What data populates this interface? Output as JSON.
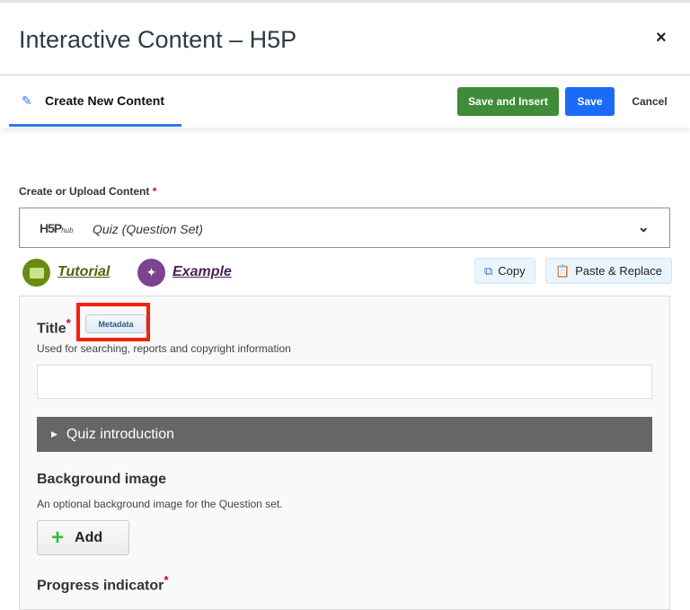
{
  "dialog": {
    "title": "Interactive Content – H5P",
    "close_icon": "×"
  },
  "toolbar": {
    "tab_label": "Create New Content",
    "save_and_insert": "Save and Insert",
    "save": "Save",
    "cancel": "Cancel"
  },
  "content": {
    "label": "Create or Upload Content",
    "required": "*",
    "hub_logo": "H5P",
    "hub_sub": "hub",
    "selected": "Quiz (Question Set)",
    "tutorial": "Tutorial",
    "example": "Example",
    "copy": "Copy",
    "paste": "Paste & Replace"
  },
  "form": {
    "title_label": "Title",
    "required": "*",
    "metadata": "Metadata",
    "title_desc": "Used for searching, reports and copyright information",
    "title_value": "",
    "intro": "Quiz introduction",
    "bg_label": "Background image",
    "bg_desc": "An optional background image for the Question set.",
    "add": "Add",
    "progress_label": "Progress indicator"
  },
  "colors": {
    "save_insert": "#3f8b37",
    "save": "#1b6bf5",
    "tutorial": "#6a8b12",
    "example": "#7c4391",
    "highlight": "#f2220e"
  }
}
